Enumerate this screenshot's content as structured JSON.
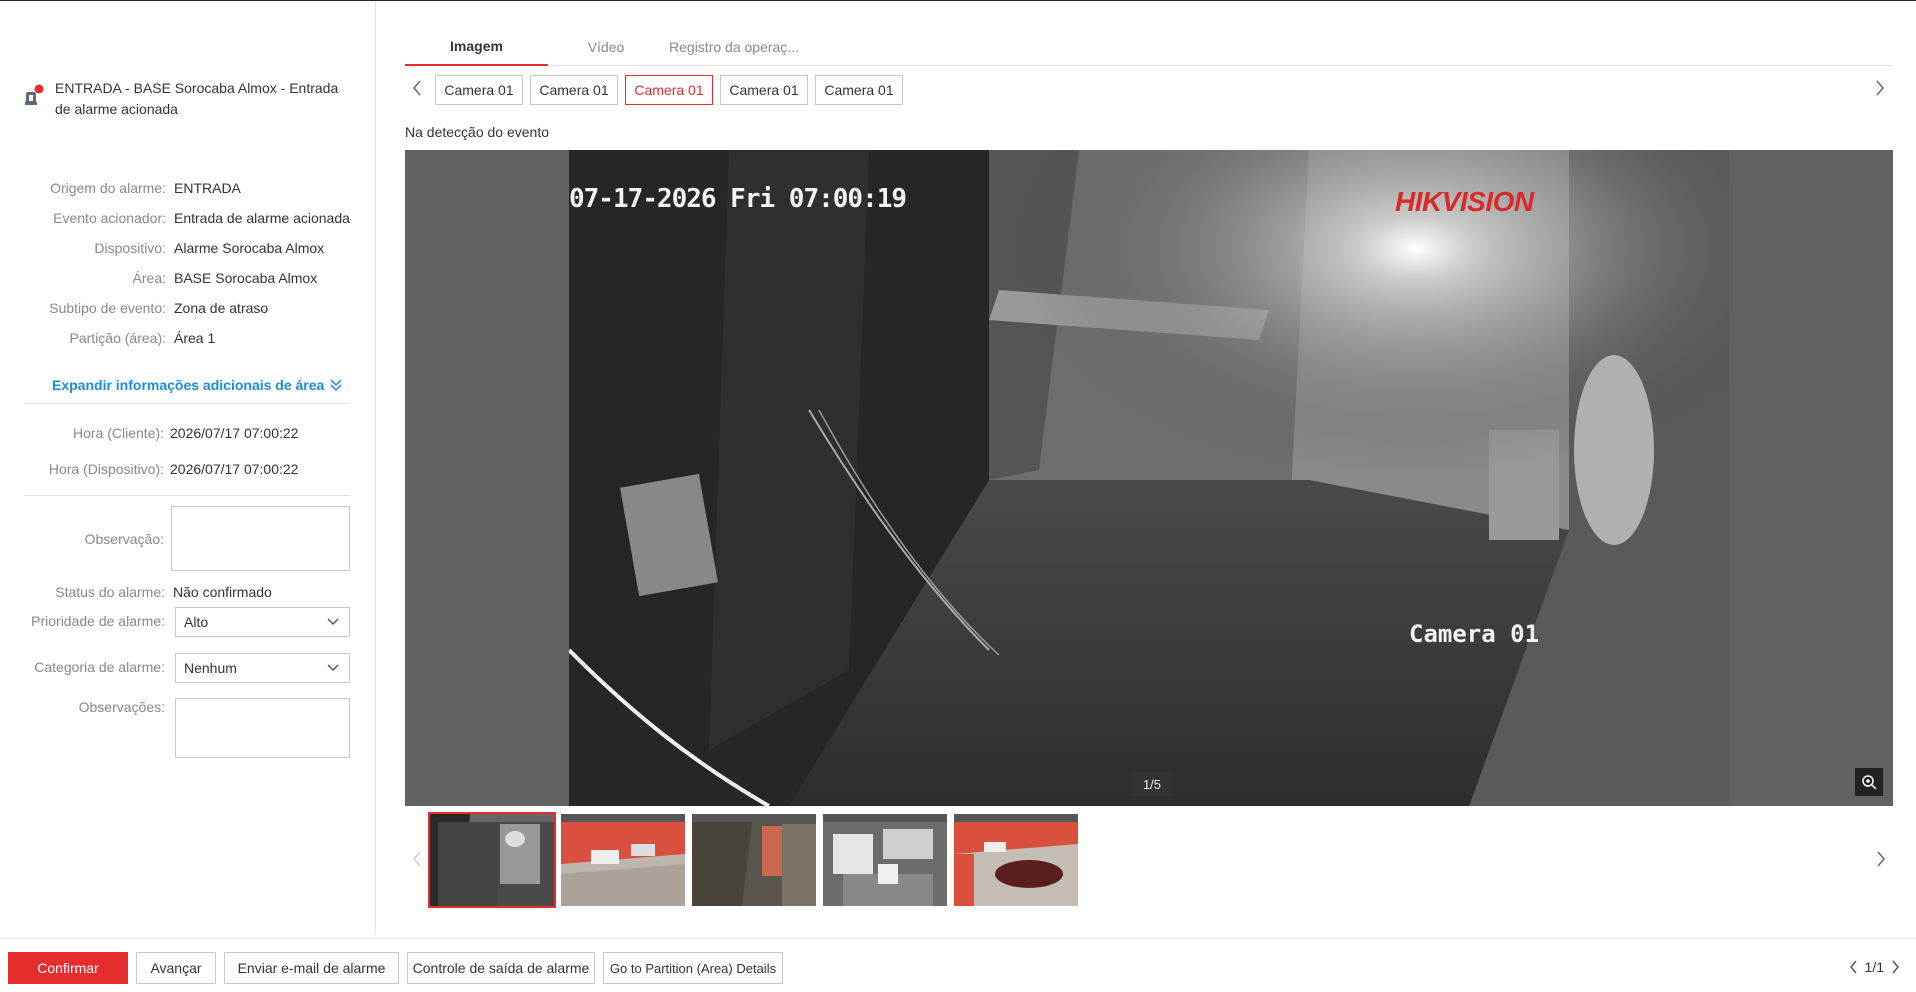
{
  "alarm": {
    "title": "ENTRADA - BASE Sorocaba Almox - Entrada de alarme acionada"
  },
  "details": [
    {
      "label": "Origem do alarme:",
      "value": "ENTRADA"
    },
    {
      "label": "Evento acionador:",
      "value": "Entrada de alarme acionada"
    },
    {
      "label": "Dispositivo:",
      "value": "Alarme Sorocaba Almox"
    },
    {
      "label": "Área:",
      "value": "BASE Sorocaba Almox"
    },
    {
      "label": "Subtipo de evento:",
      "value": "Zona de atraso"
    },
    {
      "label": "Partição (área):",
      "value": "Área 1"
    }
  ],
  "expand_label": "Expandir informações adicionais de área",
  "times": [
    {
      "label": "Hora (Cliente):",
      "value": "2026/07/17 07:00:22"
    },
    {
      "label": "Hora (Dispositivo):",
      "value": "2026/07/17 07:00:22"
    }
  ],
  "form": {
    "observacao_label": "Observação:",
    "status_label": "Status do alarme:",
    "status_value": "Não confirmado",
    "priority_label": "Prioridade de alarme:",
    "priority_value": "Alto",
    "category_label": "Categoria de alarme:",
    "category_value": "Nenhum",
    "observacoes_label": "Observações:"
  },
  "tabs": [
    "Imagem",
    "Vídeo",
    "Registro da operaç..."
  ],
  "cameras": [
    "Camera 01",
    "Camera 01",
    "Camera 01",
    "Camera 01",
    "Camera 01"
  ],
  "detect_label": "Na detecção do evento",
  "viewer": {
    "osd_time": "07-17-2026 Fri 07:00:19",
    "brand": "HIKVISION",
    "osd_camera": "Camera 01",
    "counter": "1/5"
  },
  "footer": {
    "confirm": "Confirmar",
    "advance": "Avançar",
    "email": "Enviar e-mail de alarme",
    "exit_control": "Controle de saída de alarme",
    "partition": "Go to Partition (Area) Details",
    "pager": "1/1"
  },
  "colors": {
    "accent": "#e52d2d",
    "link": "#1a8ed8"
  }
}
